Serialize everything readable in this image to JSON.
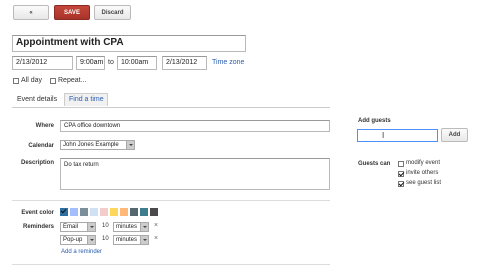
{
  "toolbar": {
    "back_label": "«",
    "save_label": "SAVE",
    "discard_label": "Discard"
  },
  "event": {
    "title": "Appointment with CPA",
    "start_date": "2/13/2012",
    "start_time": "9:00am",
    "to_label": "to",
    "end_time": "10:00am",
    "end_date": "2/13/2012",
    "timezone_link": "Time zone",
    "all_day_label": "All day",
    "repeat_label": "Repeat..."
  },
  "tabs": {
    "event_details": "Event details",
    "find_time": "Find a time"
  },
  "details": {
    "where_label": "Where",
    "where_value": "CPA office downtown",
    "calendar_label": "Calendar",
    "calendar_value": "John Jones Example",
    "description_label": "Description",
    "description_value": "Do tax return",
    "event_color_label": "Event color",
    "reminders_label": "Reminders",
    "reminders": [
      {
        "type": "Email",
        "amount": "10",
        "unit": "minutes"
      },
      {
        "type": "Pop-up",
        "amount": "10",
        "unit": "minutes"
      }
    ],
    "add_reminder_link": "Add a reminder",
    "remove_symbol": "×"
  },
  "guests": {
    "add_guests_label": "Add guests",
    "add_button": "Add",
    "input_value": "",
    "guests_can_label": "Guests can",
    "options": [
      {
        "label": "modify event",
        "checked": false
      },
      {
        "label": "invite others",
        "checked": true
      },
      {
        "label": "see guest list",
        "checked": true
      }
    ]
  },
  "colors": {
    "accent": "#a8332a",
    "swatches": [
      "#5484ed",
      "#a4bdfc",
      "#46d6db",
      "#7ae7bf",
      "#51b749",
      "#fbd75b",
      "#ffb878",
      "#ff887c",
      "#dc2127",
      "#dbadff",
      "#e1e1e1"
    ]
  }
}
